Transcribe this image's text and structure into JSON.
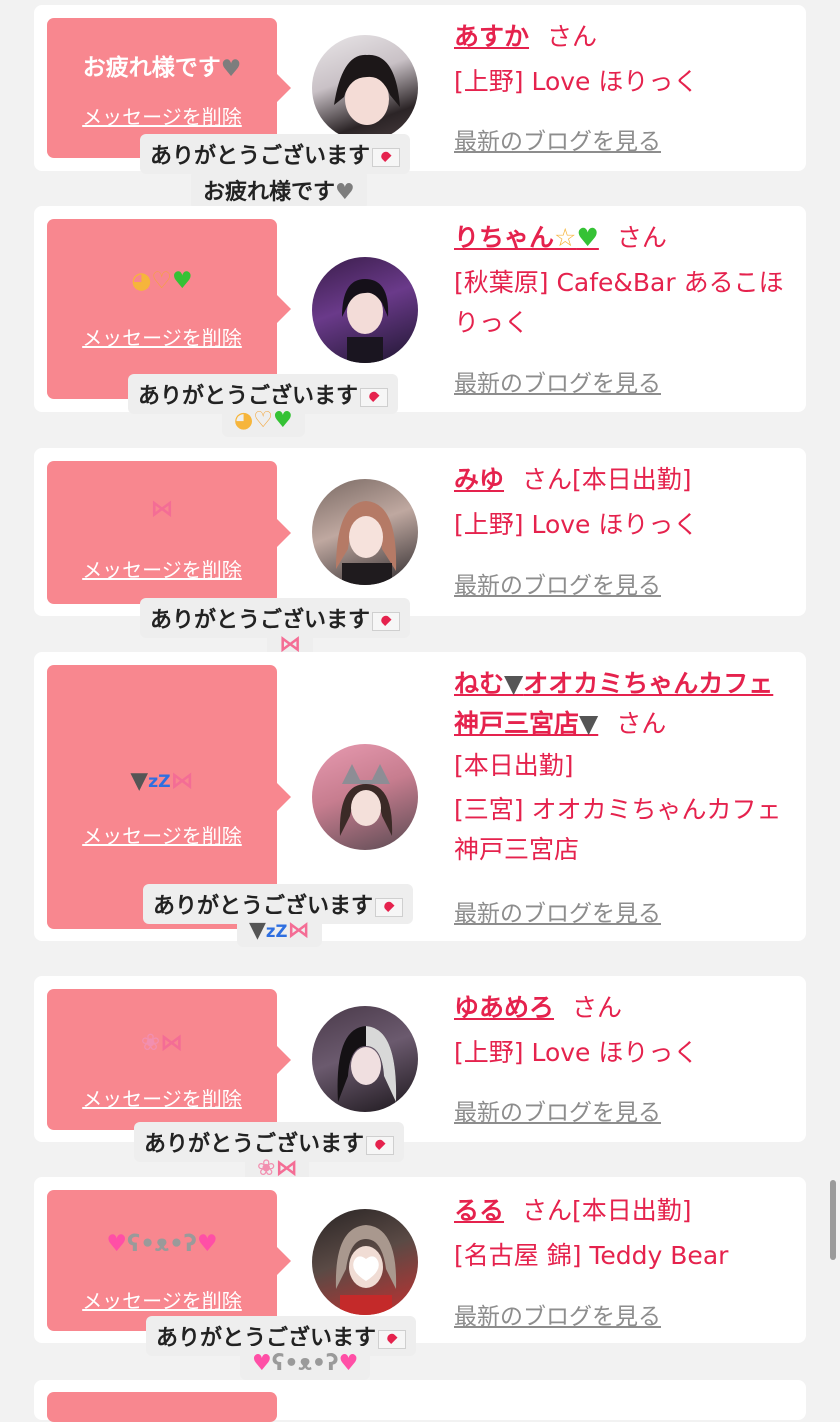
{
  "common": {
    "san": "さん",
    "delete_label": "メッセージを削除",
    "blog_label": "最新のブログを見る",
    "thanks_label": "ありがとうございます"
  },
  "cards": [
    {
      "message": "お疲れ様です",
      "name": "あすか",
      "status": "",
      "shop": "[上野] Love ほりっく",
      "reply": "お疲れ様です"
    },
    {
      "message": "",
      "name": "りちゃん",
      "status": "",
      "shop": "[秋葉原] Cafe&Bar あるこほりっく",
      "reply": ""
    },
    {
      "message": "",
      "name": "みゆ",
      "status": "[本日出勤]",
      "shop": "[上野] Love ほりっく",
      "reply": ""
    },
    {
      "message": "",
      "name": "ねむ",
      "name_mid": "オオカミちゃんカフェ神戸三宮店",
      "status": "[本日出勤]",
      "shop": "[三宮] オオカミちゃんカフェ神戸三宮店",
      "reply": ""
    },
    {
      "message": "",
      "name": "ゆあめろ",
      "status": "",
      "shop": "[上野] Love ほりっく",
      "reply": ""
    },
    {
      "message": "",
      "name": "るる",
      "status": "[本日出勤]",
      "shop": "[名古屋 錦] Teddy Bear",
      "reply": ""
    }
  ],
  "icons": {
    "gray_heart": "🩶",
    "green_heart": "💚",
    "pleading_face": "🥹",
    "heart_hands": "🫶",
    "starstruck": "🤩",
    "ribbon": "🎀",
    "wolf": "🐺",
    "zzz": "zzz",
    "brain": "🧠",
    "pink_heart": "💗",
    "rabbit": "🐰",
    "love_letter": "💌"
  },
  "colors": {
    "accent": "#e5224d",
    "bubble": "#f8878f",
    "background": "#f2f2f2"
  }
}
